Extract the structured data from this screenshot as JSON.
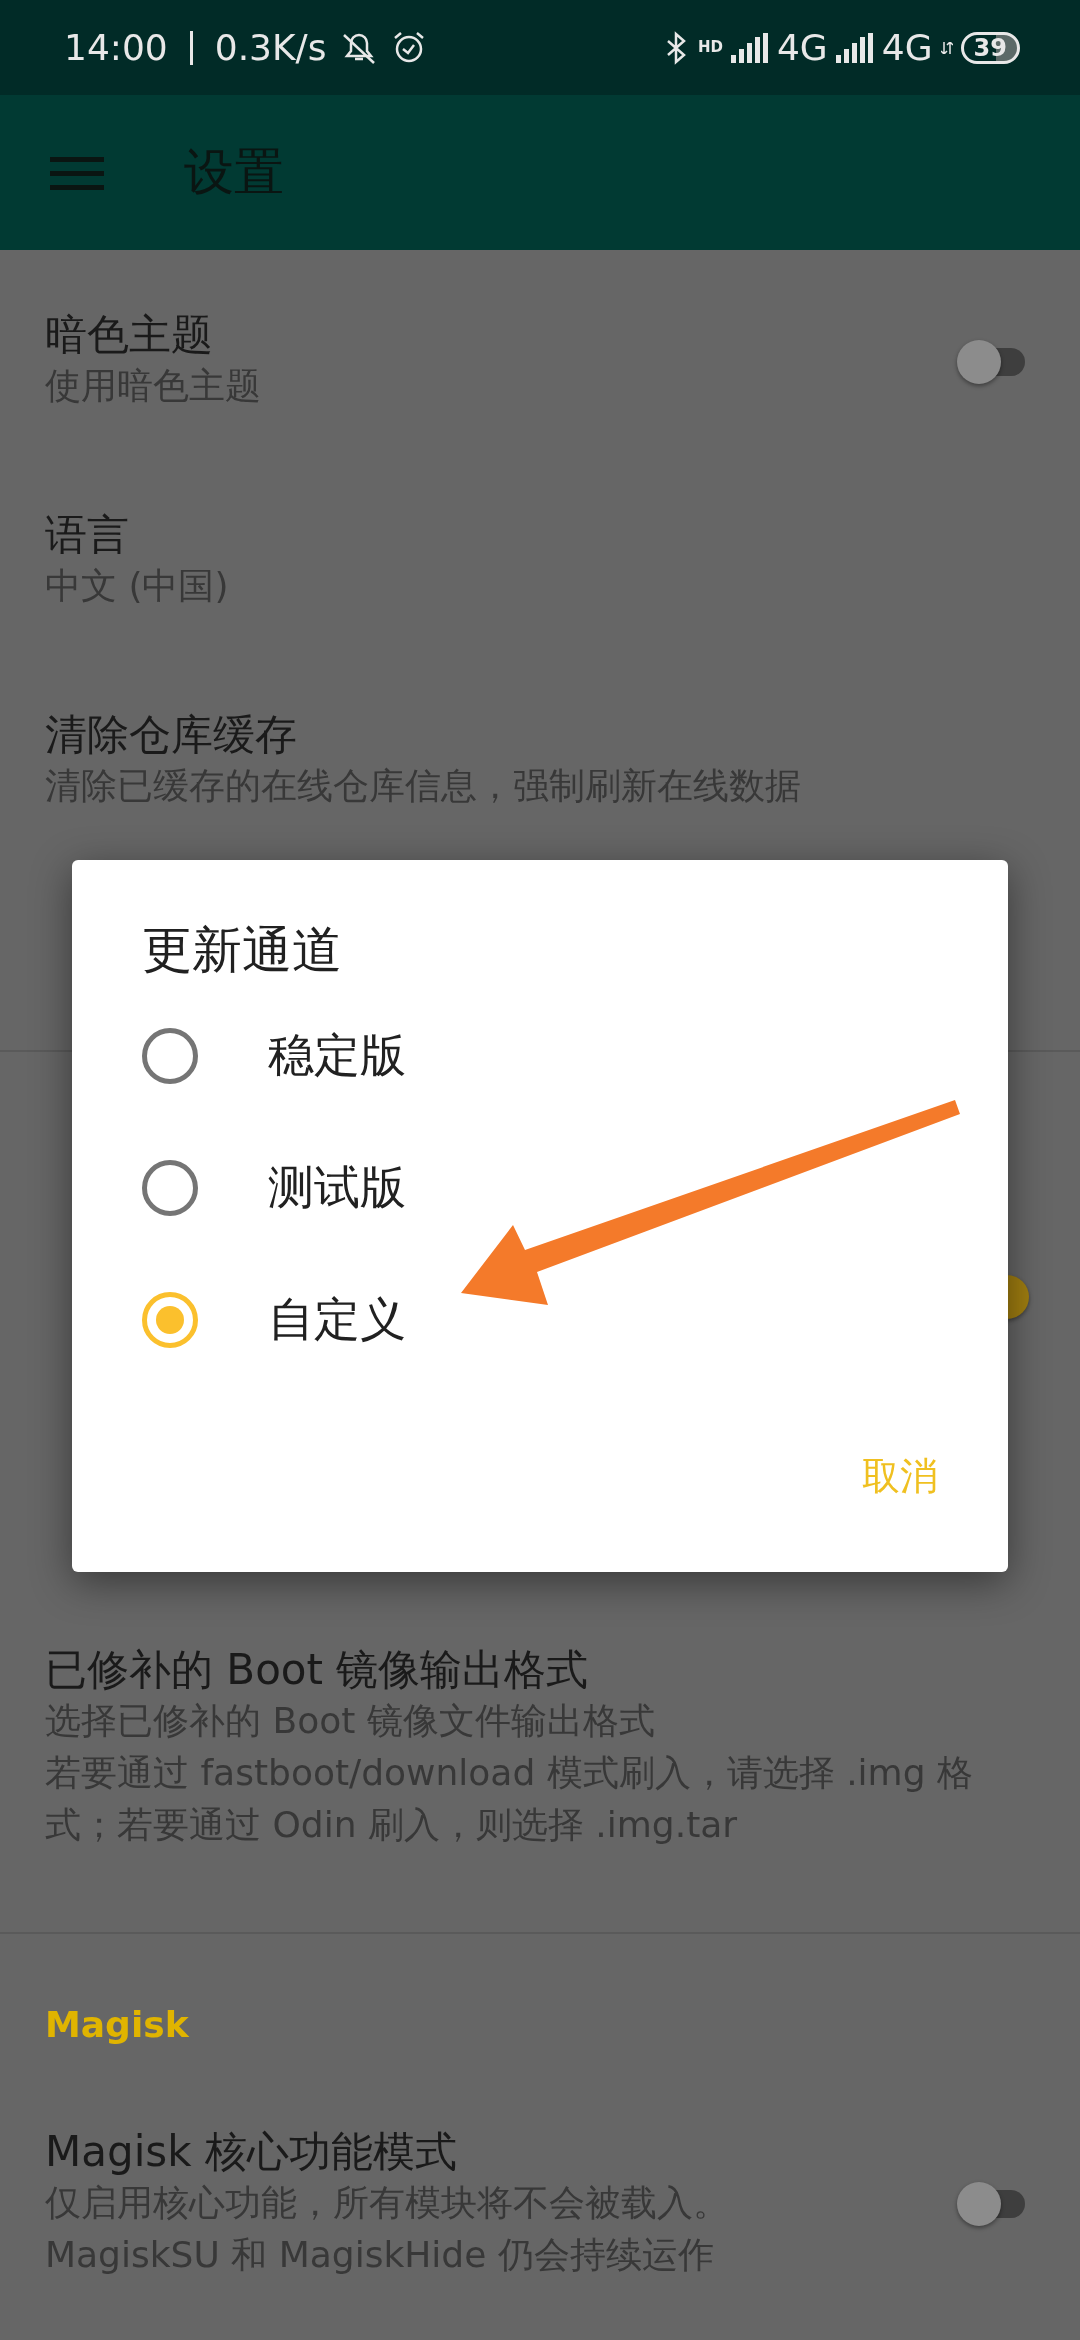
{
  "status_bar": {
    "time": "14:00",
    "net_speed": "0.3K/s",
    "sim1": {
      "badge": "HD",
      "network": "4G"
    },
    "sim2": {
      "network": "4G"
    },
    "battery": "39"
  },
  "app_bar": {
    "title": "设置"
  },
  "settings": [
    {
      "kind": "row",
      "title": "暗色主题",
      "subtitle": [
        "使用暗色主题"
      ],
      "switch": {
        "on": false
      }
    },
    {
      "kind": "row",
      "title": "语言",
      "subtitle": [
        "中文 (中国)"
      ]
    },
    {
      "kind": "row",
      "title": "清除仓库缓存",
      "subtitle": [
        "清除已缓存的在线仓库信息，强制刷新在线数据"
      ]
    },
    {
      "kind": "row"
    },
    {
      "kind": "header"
    },
    {
      "kind": "row",
      "switch": {
        "on": true
      }
    },
    {
      "kind": "row"
    },
    {
      "kind": "row",
      "title": "已修补的 Boot 镜像输出格式",
      "subtitle": [
        "选择已修补的 Boot 镜像文件输出格式",
        "若要通过 fastboot/download 模式刷入，请选择 .img 格式；若要通过 Odin 刷入，则选择 .img.tar"
      ]
    },
    {
      "kind": "header",
      "title": "Magisk"
    },
    {
      "kind": "row",
      "title": "Magisk 核心功能模式",
      "subtitle": [
        "仅启用核心功能，所有模块将不会被载入。",
        "MagiskSU 和 MagiskHide 仍会持续运作"
      ],
      "switch": {
        "on": false
      }
    }
  ],
  "dialog": {
    "title": "更新通道",
    "options": [
      {
        "label": "稳定版",
        "selected": false
      },
      {
        "label": "测试版",
        "selected": false
      },
      {
        "label": "自定义",
        "selected": true
      }
    ],
    "buttons": [
      "取消"
    ]
  }
}
